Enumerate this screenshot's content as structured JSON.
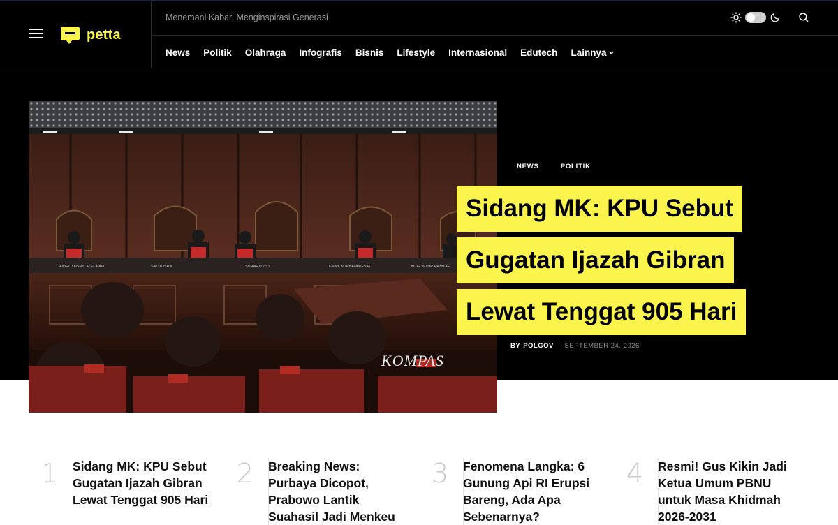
{
  "header": {
    "logo_text": "petta",
    "tagline": "Menemani Kabar, Menginspirasi Generasi",
    "accent_color": "#fbf44c",
    "nav": [
      {
        "label": "News"
      },
      {
        "label": "Politik"
      },
      {
        "label": "Olahraga"
      },
      {
        "label": "Infografis"
      },
      {
        "label": "Bisnis"
      },
      {
        "label": "Lifestyle"
      },
      {
        "label": "Internasional"
      },
      {
        "label": "Edutech"
      },
      {
        "label": "Lainnya"
      }
    ],
    "icons": [
      "menu-icon",
      "sun-icon",
      "moon-icon",
      "search-icon",
      "chevron-down-icon"
    ]
  },
  "hero": {
    "categories": [
      "NEWS",
      "POLITIK"
    ],
    "title_lines": [
      "Sidang MK: KPU Sebut",
      "Gugatan Ijazah Gibran",
      "Lewat Tenggat 905 Hari"
    ],
    "by_label": "BY",
    "author": "POLGOV",
    "separator": "·",
    "date": "SEPTEMBER 24, 2026",
    "image_watermark": "KOMPAS",
    "nameplates": [
      "DANIEL YUSMIC P FOEKH",
      "SALDI ISRA",
      "SUHARTOYO",
      "ENNY NURBANINGSIH",
      "M. GUNTUR HAMZAH"
    ]
  },
  "trending": [
    {
      "number": "1",
      "title": "Sidang MK: KPU Sebut Gugatan Ijazah Gibran Lewat Tenggat 905 Hari"
    },
    {
      "number": "2",
      "title": "Breaking News: Purbaya Dicopot, Prabowo Lantik Suahasil Jadi Menkeu"
    },
    {
      "number": "3",
      "title": "Fenomena Langka: 6 Gunung Api RI Erupsi Bareng, Ada Apa Sebenarnya?"
    },
    {
      "number": "4",
      "title": "Resmi! Gus Kikin Jadi Ketua Umum PBNU untuk Masa Khidmah 2026-2031"
    }
  ]
}
